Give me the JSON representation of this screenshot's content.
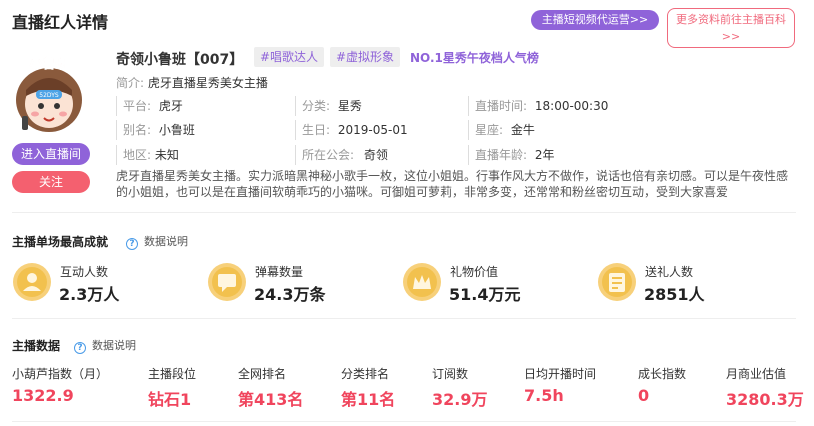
{
  "header": {
    "title": "直播红人详情",
    "promo_label": "主播短视频代运营>>",
    "wiki_label_line1": "更多资料前往主播百科",
    "wiki_label_line2": ">>"
  },
  "profile": {
    "avatar_text": "小鲁班",
    "avatar_badge": "52DYS",
    "enter_room_label": "进入直播间",
    "follow_label": "关注",
    "name": "奇领小鲁班【007】",
    "tags": [
      "#唱歌达人",
      "#虚拟形象"
    ],
    "rank_tag": "NO.1星秀午夜档人气榜",
    "intro_label": "简介:",
    "intro_value": "虎牙直播星秀美女主播",
    "fields": {
      "platform": {
        "label": "平台:",
        "value": "虎牙"
      },
      "category": {
        "label": "分类:",
        "value": "星秀"
      },
      "live_time": {
        "label": "直播时间:",
        "value": "18:00-00:30"
      },
      "alias": {
        "label": "别名:",
        "value": "小鲁班"
      },
      "birthday": {
        "label": "生日:",
        "value": "2019-05-01"
      },
      "zodiac": {
        "label": "星座:",
        "value": "金牛"
      },
      "region": {
        "label": "地区:",
        "value": "未知"
      },
      "guild": {
        "label": "所在公会:",
        "value": "奇领"
      },
      "live_years": {
        "label": "直播年龄:",
        "value": "2年"
      }
    },
    "description": "虎牙直播星秀美女主播。实力派暗黑神秘小歌手一枚，这位小姐姐。行事作风大方不做作，说话也倍有亲切感。可以是午夜性感的小姐姐，也可以是在直播间软萌乖巧的小猫咪。可御姐可萝莉，非常多变，还常常和粉丝密切互动，受到大家喜爱"
  },
  "best_record": {
    "title": "主播单场最高成就",
    "help_label": "数据说明",
    "stats": [
      {
        "label": "互动人数",
        "value": "2.3万人",
        "icon": "people-coin-icon"
      },
      {
        "label": "弹幕数量",
        "value": "24.3万条",
        "icon": "comment-coin-icon"
      },
      {
        "label": "礼物价值",
        "value": "51.4万元",
        "icon": "gift-coin-icon"
      },
      {
        "label": "送礼人数",
        "value": "2851人",
        "icon": "ledger-coin-icon"
      }
    ]
  },
  "live_data": {
    "title": "主播数据",
    "help_label": "数据说明",
    "metrics": [
      {
        "label": "小葫芦指数（月）",
        "value": "1322.9"
      },
      {
        "label": "主播段位",
        "value": "钻石1"
      },
      {
        "label": "全网排名",
        "value": "第413名"
      },
      {
        "label": "分类排名",
        "value": "第11名"
      },
      {
        "label": "订阅数",
        "value": "32.9万"
      },
      {
        "label": "日均开播时间",
        "value": "7.5h"
      },
      {
        "label": "成长指数",
        "value": "0"
      },
      {
        "label": "月商业估值",
        "value": "3280.3万"
      }
    ]
  },
  "colors": {
    "accent_purple": "#8f63d9",
    "accent_pink": "#f4606f",
    "metric_red": "#f0455d",
    "coin_gold": "#f2c14e"
  }
}
